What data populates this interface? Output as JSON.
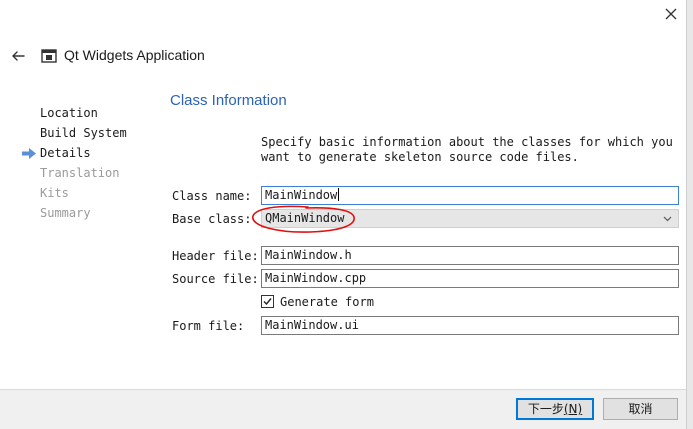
{
  "window": {
    "title": "Qt Widgets Application",
    "icons": {
      "close": "close-icon",
      "back": "back-arrow-icon",
      "app": "window-icon"
    }
  },
  "steps": [
    {
      "label": "Location",
      "state": "done"
    },
    {
      "label": "Build System",
      "state": "done"
    },
    {
      "label": "Details",
      "state": "current"
    },
    {
      "label": "Translation",
      "state": "pending"
    },
    {
      "label": "Kits",
      "state": "pending"
    },
    {
      "label": "Summary",
      "state": "pending"
    }
  ],
  "page": {
    "heading": "Class Information",
    "description": "Specify basic information about the classes for which you\nwant to generate skeleton source code files."
  },
  "form": {
    "class_name": {
      "label": "Class name:",
      "value": "MainWindow"
    },
    "base_class": {
      "label": "Base class:",
      "value": "QMainWindow"
    },
    "header_file": {
      "label": "Header file:",
      "value": "MainWindow.h"
    },
    "source_file": {
      "label": "Source file:",
      "value": "MainWindow.cpp"
    },
    "generate_form": {
      "label": "Generate form",
      "checked": true
    },
    "form_file": {
      "label": "Form file:",
      "value": "MainWindow.ui"
    }
  },
  "buttons": {
    "next_label": "下一步",
    "next_mnemonic": "(N)",
    "cancel_label": "取消"
  },
  "colors": {
    "accent": "#2b63b5",
    "current_step_arrow": "#5b8fd8",
    "annotation": "#e01010",
    "focus_border": "#3c7fd6",
    "default_button_border": "#0078d7"
  }
}
